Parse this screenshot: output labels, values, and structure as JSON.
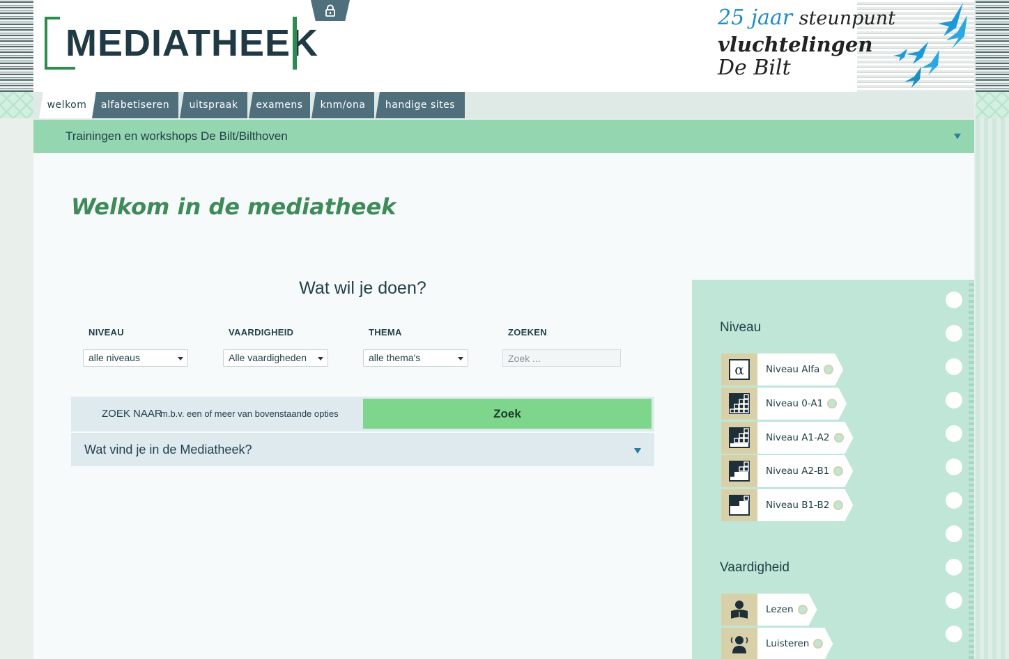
{
  "header": {
    "logo_text": "MEDIATHEEK",
    "lock": "lock-icon",
    "promo": {
      "line1_a": "25 jaar",
      "line1_b": "steunpunt",
      "line2": "vluchtelingen",
      "line3": "De Bilt"
    }
  },
  "nav": {
    "tabs": [
      {
        "label": "welkom",
        "active": true
      },
      {
        "label": "alfabetiseren"
      },
      {
        "label": "uitspraak"
      },
      {
        "label": "examens"
      },
      {
        "label": "knm/ona"
      },
      {
        "label": "handige sites"
      }
    ]
  },
  "trainingen": {
    "label": "Trainingen en workshops De Bilt/Bilthoven"
  },
  "main": {
    "title": "Welkom in de mediatheek",
    "question": "Wat wil je doen?",
    "filters": {
      "niveau": {
        "label": "NIVEAU",
        "value": "alle niveaus"
      },
      "vaardigheid": {
        "label": "VAARDIGHEID",
        "value": "Alle vaardigheden"
      },
      "thema": {
        "label": "THEMA",
        "value": "alle thema's"
      },
      "zoeken": {
        "label": "ZOEKEN",
        "placeholder": "Zoek ..."
      }
    },
    "zoek_naar": "ZOEK NAAR",
    "zoek_hint": "m.b.v. een of meer van bovenstaande opties",
    "zoek_button": "Zoek",
    "wat_vind": "Wat vind je in de Mediatheek?"
  },
  "panel": {
    "niveau_heading": "Niveau",
    "niveaus": [
      {
        "label": "Niveau Alfa",
        "icon": "alpha-icon"
      },
      {
        "label": "Niveau 0-A1",
        "icon": "level-grid-icon"
      },
      {
        "label": "Niveau A1-A2",
        "icon": "level-grid-icon"
      },
      {
        "label": "Niveau A2-B1",
        "icon": "level-grid-icon"
      },
      {
        "label": "Niveau B1-B2",
        "icon": "level-grid-icon"
      }
    ],
    "vaardigheid_heading": "Vaardigheid",
    "vaardigheden": [
      {
        "label": "Lezen",
        "icon": "reading-person-icon"
      },
      {
        "label": "Luisteren",
        "icon": "listening-person-icon"
      }
    ]
  },
  "colors": {
    "accent_green": "#3e8a58",
    "tab_blue": "#4f6f7d",
    "bar_green": "#94d6b0",
    "button_green": "#7ed68c",
    "panel_mint": "#bfe6d6"
  }
}
